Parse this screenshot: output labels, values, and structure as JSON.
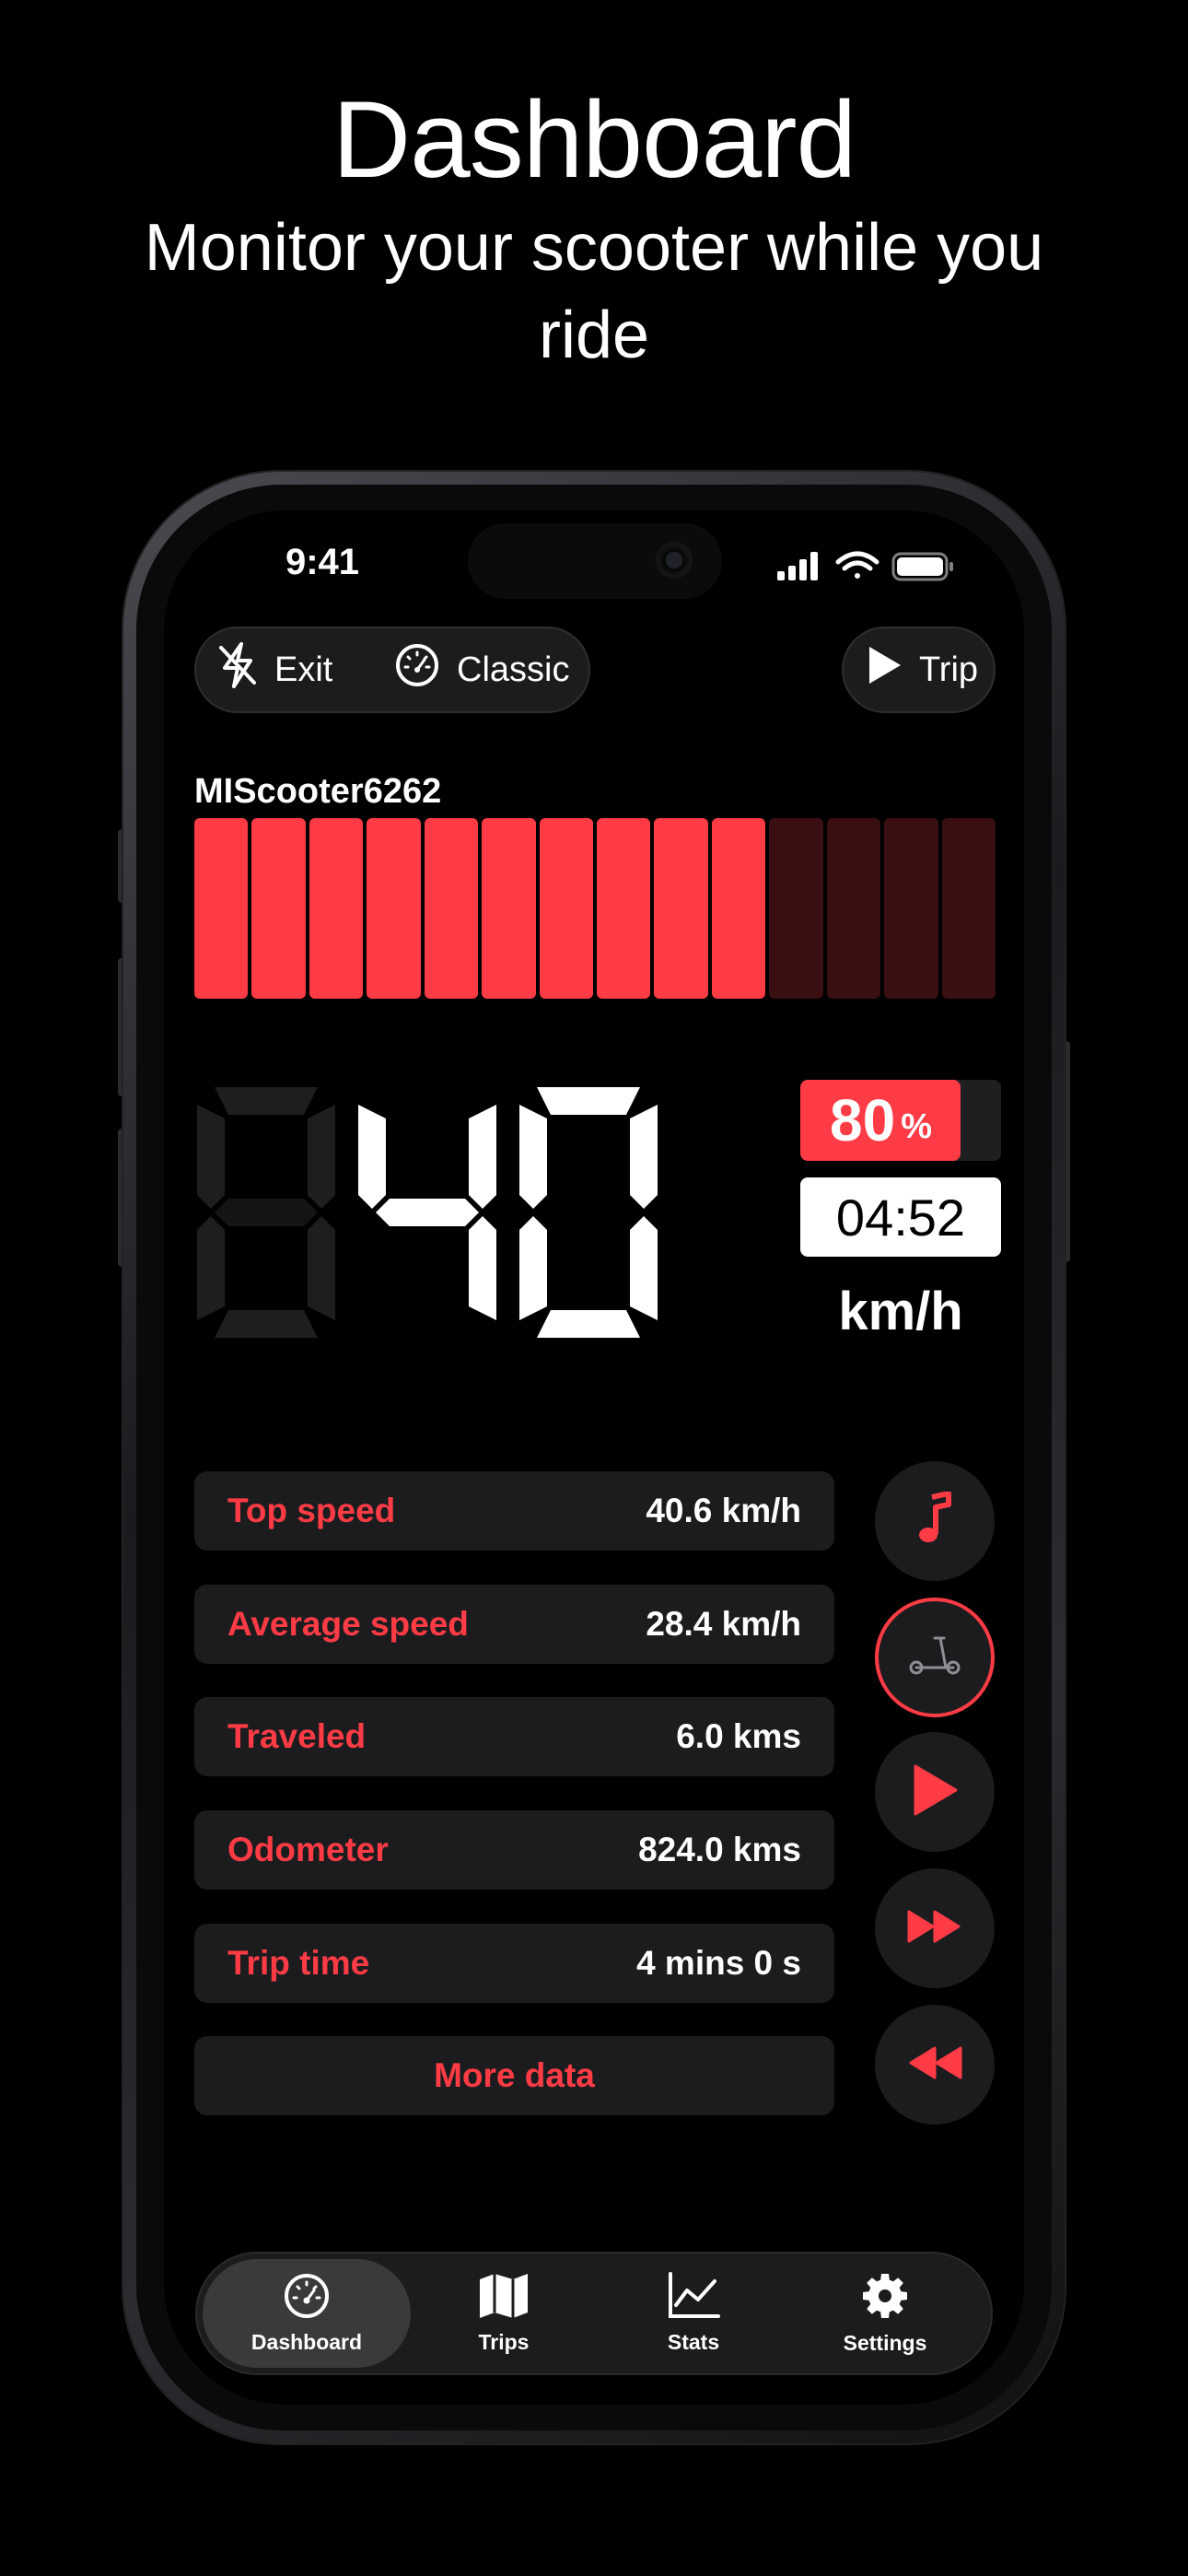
{
  "promo": {
    "title": "Dashboard",
    "subtitle": "Monitor your scooter while you ride"
  },
  "status_bar": {
    "time": "9:41"
  },
  "top_controls": {
    "exit_label": "Exit",
    "classic_label": "Classic",
    "trip_label": "Trip"
  },
  "device": {
    "name": "MIScooter6262"
  },
  "speed_gauge": {
    "active_segments": 10,
    "total_segments": 14
  },
  "speed": {
    "display": "040",
    "unit": "km/h"
  },
  "battery": {
    "value": "80",
    "symbol": "%",
    "level": 0.8
  },
  "ride_clock": "04:52",
  "stats": [
    {
      "label": "Top speed",
      "value": "40.6 km/h"
    },
    {
      "label": "Average speed",
      "value": "28.4 km/h"
    },
    {
      "label": "Traveled",
      "value": "6.0 kms"
    },
    {
      "label": "Odometer",
      "value": "824.0 kms"
    },
    {
      "label": "Trip time",
      "value": "4 mins 0 s"
    }
  ],
  "more_data_label": "More data",
  "media_controls": [
    "music-note-icon",
    "scooter-icon",
    "play-icon",
    "fast-forward-icon",
    "rewind-icon"
  ],
  "tabs": [
    {
      "label": "Dashboard",
      "icon": "gauge-icon",
      "selected": true
    },
    {
      "label": "Trips",
      "icon": "map-icon",
      "selected": false
    },
    {
      "label": "Stats",
      "icon": "chart-icon",
      "selected": false
    },
    {
      "label": "Settings",
      "icon": "gear-icon",
      "selected": false
    }
  ],
  "colors": {
    "accent": "#ff3b45",
    "dim_segment": "#3a0f12",
    "card": "#1c1c1e",
    "background": "#000000"
  }
}
